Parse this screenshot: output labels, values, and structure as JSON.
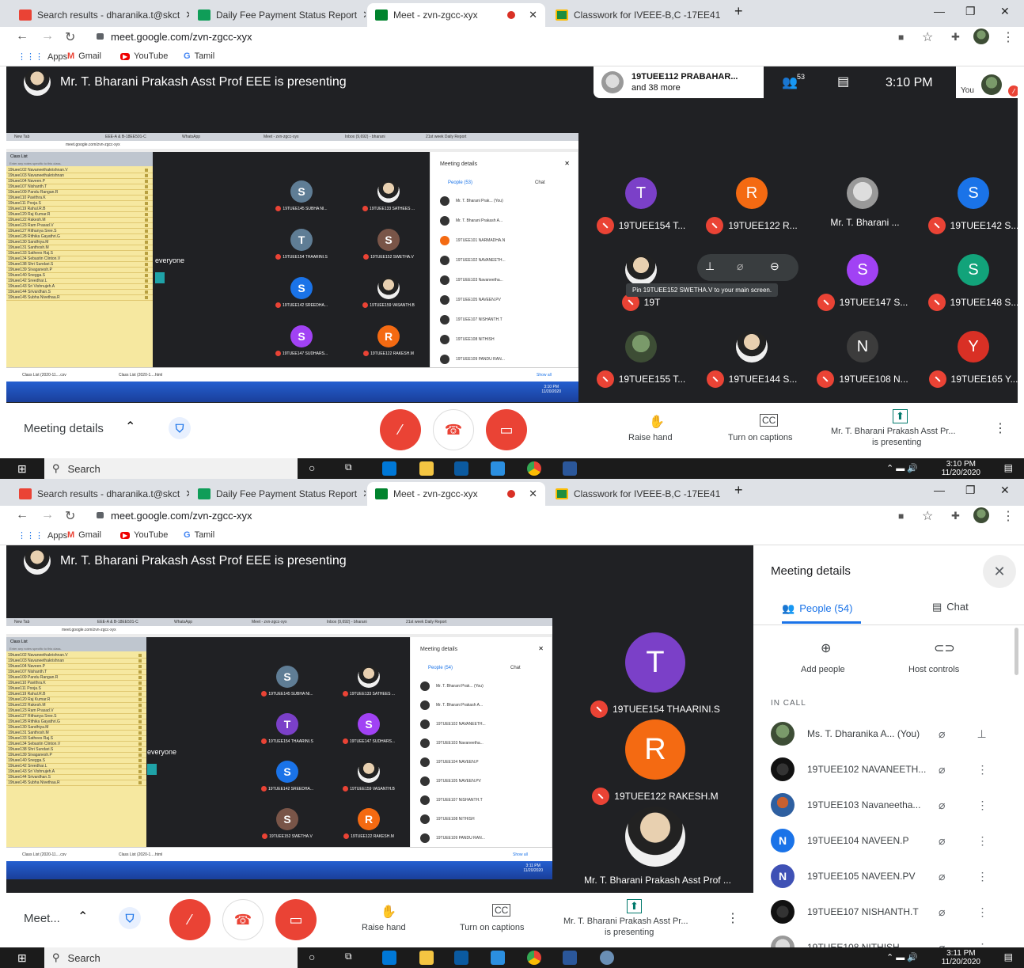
{
  "browser": {
    "tabs": [
      {
        "label": "Search results - dharanika.t@skct",
        "icon": "gmail-icon"
      },
      {
        "label": "Daily Fee Payment Status Report",
        "icon": "sheets-icon"
      },
      {
        "label": "Meet - zvn-zgcc-xyx",
        "icon": "meet-icon"
      },
      {
        "label": "Classwork for IVEEE-B,C -17EE41",
        "icon": "classroom-icon"
      }
    ],
    "url": "meet.google.com/zvn-zgcc-xyx",
    "bookmarks": [
      "Apps",
      "Gmail",
      "YouTube",
      "Tamil"
    ]
  },
  "meet": {
    "presenting_text": "Mr. T. Bharani Prakash Asst Prof EEE is presenting",
    "participant_preview_line1": "19TUEE112 PRABAHAR...",
    "participant_preview_line2": "and 38 more",
    "participant_count": "53",
    "time": "3:10 PM",
    "you_label": "You",
    "grid": [
      {
        "initial": "T",
        "color": "#7b40c8",
        "name": "19TUEE154 T..."
      },
      {
        "initial": "R",
        "color": "#f46a12",
        "name": "19TUEE122 R..."
      },
      {
        "initial": "",
        "color": "",
        "name": "Mr. T. Bharani ...",
        "photo": true
      },
      {
        "initial": "S",
        "color": "#1a73e8",
        "name": "19TUEE142 S..."
      },
      {
        "initial": "",
        "color": "",
        "name": "19T",
        "photo": true
      },
      {
        "initial": "S",
        "color": "#a142f4",
        "name": "19TUEE147 S..."
      },
      {
        "initial": "S",
        "color": "#12a37a",
        "name": "19TUEE148 S..."
      },
      {
        "initial": "",
        "color": "",
        "name": "19TUEE155 T...",
        "photo": true
      },
      {
        "initial": "",
        "color": "",
        "name": "19TUEE144 S...",
        "photo": true
      },
      {
        "initial": "N",
        "color": "#3c3c3c",
        "name": "19TUEE108 N..."
      },
      {
        "initial": "Y",
        "color": "#d93025",
        "name": "19TUEE165 Y..."
      }
    ],
    "pin_tooltip": "Pin 19TUEE152 SWETHA.V to your main screen.",
    "controls": {
      "meeting_details": "Meeting details",
      "meeting_details_short": "Meet...",
      "raise_hand": "Raise hand",
      "captions": "Turn on captions",
      "presenting_line1": "Mr. T. Bharani Prakash Asst Pr...",
      "presenting_line2": "is presenting"
    }
  },
  "taskbar": {
    "search": "Search",
    "time1": "3:10 PM",
    "date1": "11/20/2020",
    "time2": "3:11 PM",
    "date2": "11/20/2020",
    "notif_count": "5"
  },
  "mini": {
    "tabs": [
      "New Tab",
      "EEE-A & B-18EE501-C",
      "WhatsApp",
      "Meet - zvn-zgcc-xyx",
      "Inbox (9,692) - bharani",
      "21st week Daily Report"
    ],
    "url": "meet.google.com/zvn-zgcc-xyx",
    "class_list": "Class List",
    "notes": "Enter any notes specific to this class.",
    "everyone": "everyone",
    "sheet_rows": [
      "19tuee102 Navaneethakrishnan.V",
      "19tuee103 Navaneethakrishnan",
      "19tuee104 Naveen.P",
      "19tuee107 Nishanth.T",
      "19tuee109 Pandu Rangan.R",
      "19tuee110 Pavithra.K",
      "19tuee111 Pooja.S",
      "19tuee119 Rahul.R.B",
      "19tuee120 Raj Kumar.R",
      "19tuee122 Rakesh.M",
      "19tuee123 Ram Prasad.V",
      "19tuee127 Rithanya Sree.S",
      "19tuee128 Rithika Gayathri.G",
      "19tuee130 Sandhiya.M",
      "19tuee131 Santhosh.M",
      "19tuee133 Sathees Raj.S",
      "19tuee134 Sebastin Clinton.V",
      "19tuee138 Shri Sundari.S",
      "19tuee139 Sivaganesh.P",
      "19tuee140 Snegga.S",
      "19tuee142 Sreedhar.L",
      "19tuee143 Sri Vishnujeh.A",
      "19tuee144 Srivardhan.S",
      "19tuee145 Subha Nivethaa.R"
    ],
    "tiles1": [
      {
        "initial": "S",
        "color": "#5f7d95",
        "name": "19TUEE145 SUBHA NI..."
      },
      {
        "initial": "",
        "color": "",
        "name": "19TUEE133 SATHEES ...",
        "photo": true
      },
      {
        "initial": "T",
        "color": "#5f7d95",
        "name": "19TUEE154 THAARINI.S"
      },
      {
        "initial": "S",
        "color": "#795548",
        "name": "19TUEE152 SWETHA.V"
      },
      {
        "initial": "S",
        "color": "#1a73e8",
        "name": "19TUEE142 SREEDHA..."
      },
      {
        "initial": "",
        "color": "",
        "name": "19TUEE159 VASANTH.B",
        "photo": true
      },
      {
        "initial": "S",
        "color": "#a142f4",
        "name": "19TUEE147 SUDHARS..."
      },
      {
        "initial": "R",
        "color": "#f46a12",
        "name": "19TUEE122 RAKESH.M"
      }
    ],
    "tiles2": [
      {
        "initial": "S",
        "color": "#5f7d95",
        "name": "19TUEE145 SUBHA NI..."
      },
      {
        "initial": "",
        "color": "",
        "name": "19TUEE133 SATHEES ...",
        "photo": true
      },
      {
        "initial": "T",
        "color": "#7b40c8",
        "name": "19TUEE154 THAARINI.S"
      },
      {
        "initial": "S",
        "color": "#a142f4",
        "name": "19TUEE147 SUDHARS..."
      },
      {
        "initial": "S",
        "color": "#1a73e8",
        "name": "19TUEE142 SREEDHA..."
      },
      {
        "initial": "",
        "color": "",
        "name": "19TUEE159 VASANTH.B",
        "photo": true
      },
      {
        "initial": "S",
        "color": "#795548",
        "name": "19TUEE152 SWETHA.V"
      },
      {
        "initial": "R",
        "color": "#f46a12",
        "name": "19TUEE122 RAKESH.M"
      }
    ],
    "panel_title": "Meeting details",
    "people_tab1": "People (53)",
    "people_tab2": "People (54)",
    "chat_tab": "Chat",
    "people1": [
      "Mr. T. Bharani Prak... (You)",
      "Mr. T. Bharani Prakash A...",
      "19TUEE101 NARMADHA.N",
      "19TUEE102 NAVANEETH...",
      "19TUEE103 Navaneetha...",
      "19TUEE105 NAVEEN.PV",
      "19TUEE107 NISHANTH.T",
      "19TUEE108 NITHISH",
      "19TUEE109 PANDU RAN..."
    ],
    "people2": [
      "Mr. T. Bharani Prak... (You)",
      "Mr. T. Bharani Prakash A...",
      "19TUEE102 NAVANEETH...",
      "19TUEE103 Navaneetha...",
      "19TUEE104 NAVEEN.P",
      "19TUEE105 NAVEEN.PV",
      "19TUEE107 NISHANTH.T",
      "19TUEE108 NITHISH",
      "19TUEE109 PANDU RAN..."
    ],
    "your_presentation": "Your presentation",
    "downloads": [
      "Class List (2020-11....csv",
      "Class List (2020-1....html"
    ],
    "show_all": "Show all",
    "mini_time1": "3:10 PM",
    "mini_time2": "3:11 PM",
    "mini_date": "11/20/2020"
  },
  "screen2": {
    "side_tiles": [
      {
        "initial": "T",
        "color": "#7b40c8",
        "name": "19TUEE154 THAARINI.S"
      },
      {
        "initial": "R",
        "color": "#f46a12",
        "name": "19TUEE122 RAKESH.M"
      },
      {
        "initial": "",
        "color": "",
        "name": "Mr. T. Bharani Prakash Asst Prof ...",
        "photo": true
      }
    ],
    "panel": {
      "title": "Meeting details",
      "people_tab": "People (54)",
      "chat_tab": "Chat",
      "add_people": "Add people",
      "host_controls": "Host controls",
      "in_call": "IN CALL",
      "participants": [
        {
          "name": "Ms. T. Dharanika A... (You)",
          "initial": "",
          "color": ""
        },
        {
          "name": "19TUEE102 NAVANEETH...",
          "initial": "",
          "color": ""
        },
        {
          "name": "19TUEE103 Navaneetha...",
          "initial": "",
          "color": ""
        },
        {
          "name": "19TUEE104 NAVEEN.P",
          "initial": "N",
          "color": "#1a73e8"
        },
        {
          "name": "19TUEE105 NAVEEN.PV",
          "initial": "N",
          "color": "#3f51b5"
        },
        {
          "name": "19TUEE107 NISHANTH.T",
          "initial": "",
          "color": ""
        },
        {
          "name": "19TUEE108 NITHISH",
          "initial": "",
          "color": ""
        }
      ]
    }
  }
}
